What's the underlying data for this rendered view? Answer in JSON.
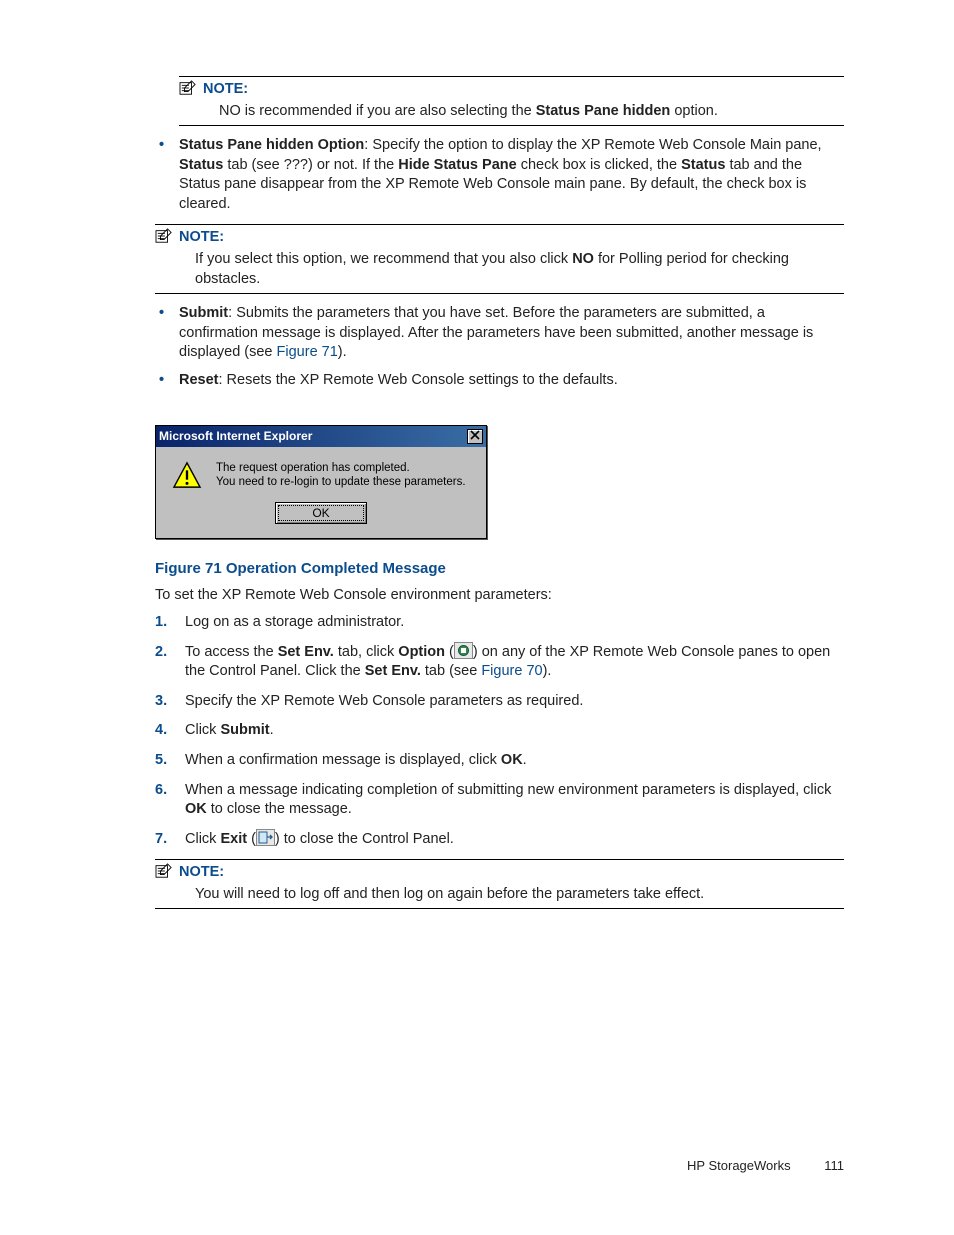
{
  "notes": {
    "n1_label": "NOTE:",
    "n1_body_pre": "NO is recommended if you are also selecting the ",
    "n1_body_bold": "Status Pane hidden",
    "n1_body_post": " option.",
    "n2_label": "NOTE:",
    "n2_body_pre": "If you select this option, we recommend that you also click ",
    "n2_body_bold": "NO",
    "n2_body_post": " for Polling period for checking obstacles.",
    "n3_label": "NOTE:",
    "n3_body": "You will need to log off and then log on again before the parameters take effect."
  },
  "bullets_a": {
    "b1_bold": "Status Pane hidden Option",
    "b1_t1": ": Specify the option to display the XP Remote Web Console Main pane, ",
    "b1_bold2": "Status",
    "b1_t2": " tab (see ???) or not. If the ",
    "b1_bold3": "Hide Status Pane",
    "b1_t3": " check box is clicked, the ",
    "b1_bold4": "Status",
    "b1_t4": " tab and the Status pane disappear from the XP Remote Web Console main pane. By default, the check box is cleared."
  },
  "bullets_b": {
    "b1_bold": "Submit",
    "b1_t1": ": Submits the parameters that you have set. Before the parameters are submitted, a confirmation message is displayed. After the parameters have been submitted, another message is displayed (see ",
    "b1_link": "Figure 71",
    "b1_t2": ").",
    "b2_bold": "Reset",
    "b2_t1": ": Resets the XP Remote Web Console settings to the defaults."
  },
  "dialog": {
    "title": "Microsoft Internet Explorer",
    "line1": "The request operation has completed.",
    "line2": "You need to re-login to update these parameters.",
    "ok": "OK"
  },
  "figure_caption": "Figure 71 Operation Completed Message",
  "intro": "To set the XP Remote Web Console environment parameters:",
  "steps": {
    "s1": "Log on as a storage administrator.",
    "s2_t1": "To access the ",
    "s2_b1": "Set Env.",
    "s2_t2": " tab, click ",
    "s2_b2": "Option",
    "s2_t3": " (",
    "s2_t4": ") on any of the XP Remote Web Console panes to open the Control Panel. Click the ",
    "s2_b3": "Set Env.",
    "s2_t5": " tab (see ",
    "s2_link": "Figure 70",
    "s2_t6": ").",
    "s3": "Specify the XP Remote Web Console parameters as required.",
    "s4_t1": "Click ",
    "s4_b1": "Submit",
    "s4_t2": ".",
    "s5_t1": "When a confirmation message is displayed, click ",
    "s5_b1": "OK",
    "s5_t2": ".",
    "s6_t1": "When a message indicating completion of submitting new environment parameters is displayed, click ",
    "s6_b1": "OK",
    "s6_t2": " to close the message.",
    "s7_t1": "Click ",
    "s7_b1": "Exit",
    "s7_t2": " (",
    "s7_t3": ") to close the Control Panel."
  },
  "footer": {
    "title": "HP StorageWorks",
    "page": "111"
  }
}
